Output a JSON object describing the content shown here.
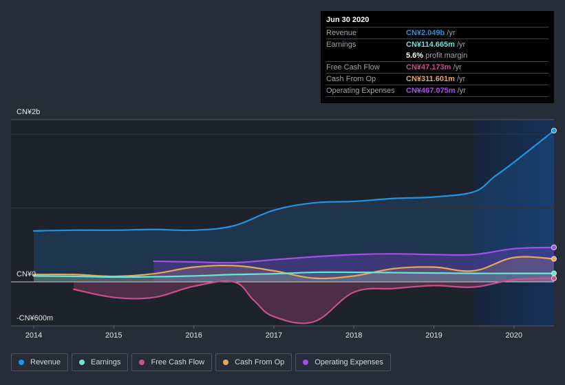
{
  "tooltip": {
    "date": "Jun 30 2020",
    "rows": [
      {
        "label": "Revenue",
        "value": "CN¥2.049b",
        "unit": "/yr",
        "color": "#2394df"
      },
      {
        "label": "Earnings",
        "value": "CN¥114.665m",
        "unit": "/yr",
        "color": "#6ce5d9"
      },
      {
        "label": "Free Cash Flow",
        "value": "CN¥47.173m",
        "unit": "/yr",
        "color": "#c94f8e"
      },
      {
        "label": "Cash From Op",
        "value": "CN¥311.601m",
        "unit": "/yr",
        "color": "#e8a95f"
      },
      {
        "label": "Operating Expenses",
        "value": "CN¥467.075m",
        "unit": "/yr",
        "color": "#a64ee8"
      }
    ],
    "profit_margin_value": "5.6%",
    "profit_margin_label": "profit margin"
  },
  "legend": [
    {
      "label": "Revenue",
      "color": "#2394df"
    },
    {
      "label": "Earnings",
      "color": "#6ce5d9"
    },
    {
      "label": "Free Cash Flow",
      "color": "#c94f8e"
    },
    {
      "label": "Cash From Op",
      "color": "#e8a95f"
    },
    {
      "label": "Operating Expenses",
      "color": "#a64ee8"
    }
  ],
  "chart_data": {
    "type": "area",
    "title": "",
    "xlabel": "",
    "ylabel": "",
    "y_unit": "CN¥ billions",
    "ylim": [
      -0.6,
      2.2
    ],
    "xlim": [
      2013.7,
      2020.5
    ],
    "y_tick_labels": [
      {
        "value": 2.0,
        "label": "CN¥2b"
      },
      {
        "value": 0,
        "label": "CN¥0"
      },
      {
        "value": -0.6,
        "label": "-CN¥600m"
      }
    ],
    "x_tick_labels": [
      "2014",
      "2015",
      "2016",
      "2017",
      "2018",
      "2019",
      "2020"
    ],
    "x_ticks": [
      2014,
      2015,
      2016,
      2017,
      2018,
      2019,
      2020
    ],
    "grid": true,
    "highlight_range": [
      2019.5,
      2020.5
    ],
    "legend_position": "bottom",
    "series": [
      {
        "name": "Revenue",
        "color": "#2394df",
        "x": [
          2014.0,
          2014.5,
          2015.0,
          2015.5,
          2016.0,
          2016.5,
          2017.0,
          2017.5,
          2018.0,
          2018.5,
          2019.0,
          2019.5,
          2019.75,
          2020.0,
          2020.5
        ],
        "values": [
          0.69,
          0.7,
          0.7,
          0.71,
          0.7,
          0.76,
          0.97,
          1.07,
          1.09,
          1.13,
          1.15,
          1.22,
          1.42,
          1.62,
          2.049
        ]
      },
      {
        "name": "Operating Expenses",
        "color": "#a64ee8",
        "x": [
          2015.5,
          2016.0,
          2016.5,
          2017.0,
          2017.5,
          2018.0,
          2018.5,
          2019.0,
          2019.5,
          2020.0,
          2020.5
        ],
        "values": [
          0.28,
          0.27,
          0.26,
          0.3,
          0.34,
          0.37,
          0.38,
          0.37,
          0.37,
          0.45,
          0.467
        ]
      },
      {
        "name": "Cash From Op",
        "color": "#e8a95f",
        "x": [
          2014.0,
          2014.5,
          2015.0,
          2015.5,
          2016.0,
          2016.5,
          2017.0,
          2017.5,
          2018.0,
          2018.5,
          2019.0,
          2019.5,
          2020.0,
          2020.5
        ],
        "values": [
          0.1,
          0.1,
          0.075,
          0.11,
          0.2,
          0.22,
          0.15,
          0.05,
          0.08,
          0.18,
          0.2,
          0.15,
          0.33,
          0.312
        ]
      },
      {
        "name": "Earnings",
        "color": "#6ce5d9",
        "x": [
          2014.0,
          2014.5,
          2015.0,
          2015.5,
          2016.0,
          2016.5,
          2017.0,
          2017.5,
          2018.0,
          2018.5,
          2019.0,
          2019.5,
          2020.0,
          2020.5
        ],
        "values": [
          0.08,
          0.075,
          0.065,
          0.07,
          0.08,
          0.1,
          0.11,
          0.13,
          0.13,
          0.125,
          0.12,
          0.115,
          0.115,
          0.115
        ]
      },
      {
        "name": "Free Cash Flow",
        "color": "#c94f8e",
        "x": [
          2014.5,
          2015.0,
          2015.5,
          2016.0,
          2016.5,
          2016.75,
          2017.0,
          2017.5,
          2018.0,
          2018.5,
          2019.0,
          2019.5,
          2020.0,
          2020.5
        ],
        "values": [
          -0.1,
          -0.21,
          -0.21,
          -0.06,
          0.0,
          -0.25,
          -0.47,
          -0.54,
          -0.14,
          -0.09,
          -0.05,
          -0.07,
          0.03,
          0.047
        ]
      }
    ]
  }
}
